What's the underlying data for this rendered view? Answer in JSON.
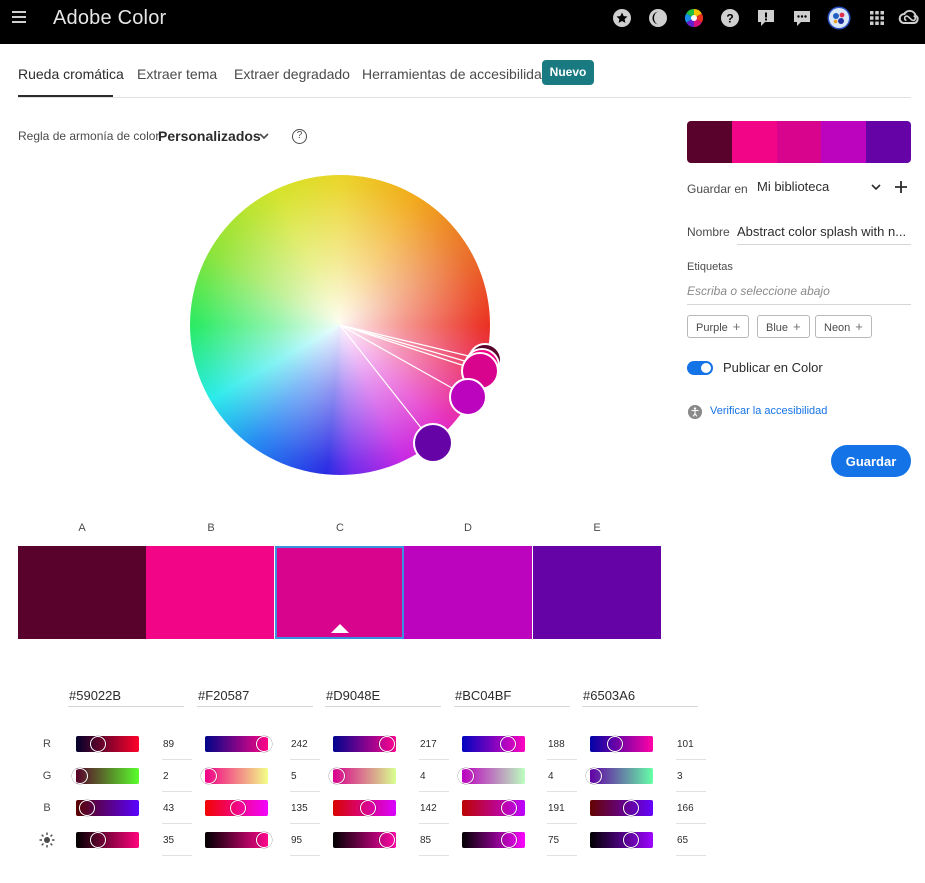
{
  "app": {
    "title": "Adobe Color"
  },
  "topbar_icons": [
    "star-icon",
    "moon-icon",
    "color-wheel-icon",
    "help-icon",
    "feedback-icon",
    "chat-icon",
    "user-avatar",
    "apps-grid-icon",
    "creative-cloud-icon"
  ],
  "tabs": [
    {
      "label": "Rueda cromática",
      "active": true
    },
    {
      "label": "Extraer tema",
      "active": false
    },
    {
      "label": "Extraer degradado",
      "active": false
    },
    {
      "label": "Herramientas de accesibilidad",
      "active": false
    }
  ],
  "new_badge": "Nuevo",
  "harmony": {
    "label": "Regla de armonía de color",
    "value": "Personalizados",
    "help": "?"
  },
  "panel": {
    "save_in_label": "Guardar en",
    "library": "Mi biblioteca",
    "name_label": "Nombre",
    "name_value": "Abstract color splash with n...",
    "tags_label": "Etiquetas",
    "tags_placeholder": "Escriba o seleccione abajo",
    "tags": [
      "Purple",
      "Blue",
      "Neon"
    ],
    "publish_label": "Publicar en Color",
    "publish_on": true,
    "accessibility_link": "Verificar la accesibilidad",
    "save_button": "Guardar"
  },
  "swatches": [
    {
      "letter": "A",
      "hex": "#59022B",
      "r": 89,
      "g": 2,
      "b": 43,
      "brightness": 35
    },
    {
      "letter": "B",
      "hex": "#F20587",
      "r": 242,
      "g": 5,
      "b": 135,
      "brightness": 95
    },
    {
      "letter": "C",
      "hex": "#D9048E",
      "r": 217,
      "g": 4,
      "b": 142,
      "brightness": 85
    },
    {
      "letter": "D",
      "hex": "#BC04BF",
      "r": 188,
      "g": 4,
      "b": 191,
      "brightness": 75
    },
    {
      "letter": "E",
      "hex": "#6503A6",
      "r": 101,
      "g": 3,
      "b": 166,
      "brightness": 65
    }
  ],
  "selected_swatch": "C",
  "row_labels": {
    "r": "R",
    "g": "G",
    "b": "B",
    "brightness": "brightness-icon"
  }
}
